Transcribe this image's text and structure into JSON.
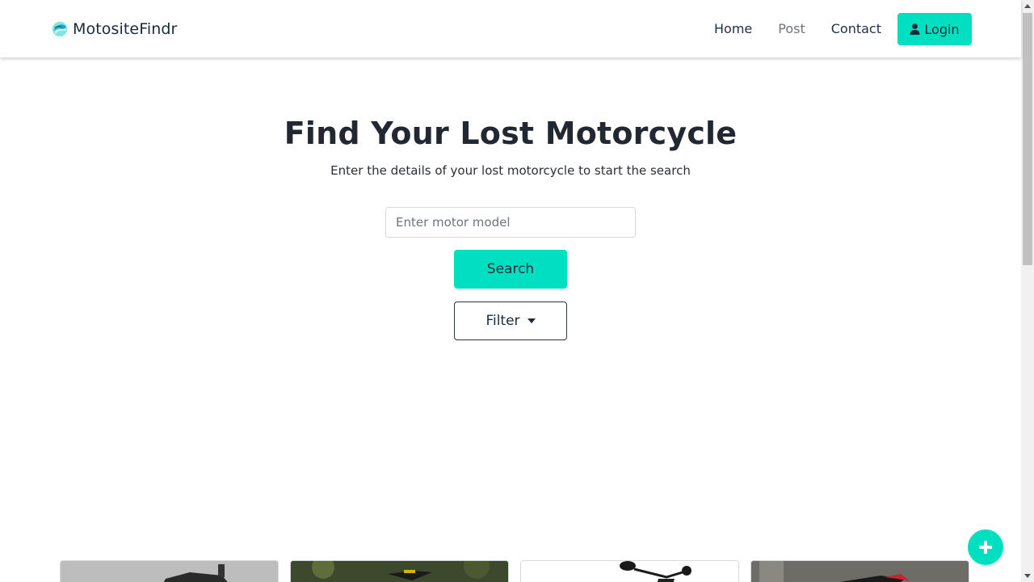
{
  "colors": {
    "accent": "#00e0c0",
    "text_dark": "#1b2a3a",
    "muted": "#6c757d"
  },
  "navbar": {
    "brand": {
      "name": "MotositeFindr",
      "logo_icon": "helmet-logo-icon"
    },
    "links": [
      {
        "label": "Home"
      },
      {
        "label": "Post"
      },
      {
        "label": "Contact"
      }
    ],
    "login": {
      "label": "Login",
      "icon": "user-icon"
    }
  },
  "hero": {
    "title": "Find Your Lost Motorcycle",
    "subtitle": "Enter the details of your lost motorcycle to start the search",
    "search_placeholder": "Enter motor model",
    "search_value": "",
    "search_button": "Search",
    "filter_button": "Filter"
  },
  "cards": [
    {
      "image": "motorcycle-photo-1"
    },
    {
      "image": "motorcycle-photo-2"
    },
    {
      "image": "motorcycle-photo-3"
    },
    {
      "image": "motorcycle-photo-4"
    }
  ],
  "fab": {
    "icon": "plus-icon"
  }
}
